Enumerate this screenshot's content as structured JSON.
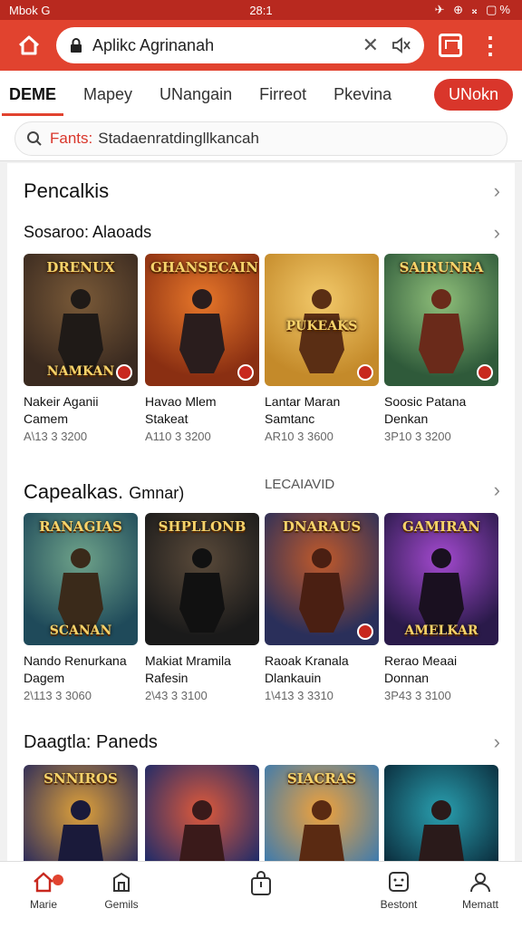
{
  "status": {
    "left": "Mbok G",
    "time": "28:1",
    "right": "✈ ⊕ 𝄪 ▢%"
  },
  "browser": {
    "url": "Aplikc Agrinanah"
  },
  "tabs": [
    {
      "label": "DEME",
      "active": true
    },
    {
      "label": "Mapey"
    },
    {
      "label": "UNangain"
    },
    {
      "label": "Firreot"
    },
    {
      "label": "Pkevina"
    }
  ],
  "tab_cta": "UNokn",
  "search": {
    "prefix": "Fants:",
    "text": "Stadaenratdingllkancah"
  },
  "sections": {
    "pencalkis": {
      "title": "Pencalkis"
    },
    "row1": {
      "title": "Sosaroo: Alaoads",
      "items": [
        {
          "cover_title": "DRENUX",
          "cover_sub": "NAMKAN",
          "name_1": "Nakeir Aganii",
          "name_2": "Camem",
          "price": "A\\13 3 3200",
          "bg1": "#3a2a20",
          "bg2": "#7a5a38",
          "hero": "#1f1a17"
        },
        {
          "cover_title": "GHANSECAIN",
          "cover_sub": "",
          "name_1": "Havao Mlem",
          "name_2": "Stakeat",
          "price": "A110 3 3200",
          "bg1": "#8a2f12",
          "bg2": "#e7772a",
          "hero": "#2a1d1d"
        },
        {
          "cover_title": "",
          "cover_sub": "PUKEAKS",
          "name_1": "Lantar Maran",
          "name_2": "Samtanc",
          "price": "AR10 3 3600",
          "bg1": "#c48a2a",
          "bg2": "#f2c96a",
          "hero": "#5a2e14"
        },
        {
          "cover_title": "SAIRUNRA",
          "cover_sub": "",
          "name_1": "Soosic Patana",
          "name_2": "Denkan",
          "price": "3P10 3 3200",
          "bg1": "#2f5a3a",
          "bg2": "#8fbf7a",
          "hero": "#6a2a1a"
        }
      ]
    },
    "row2": {
      "title": "Capealkas.",
      "title_extra": "Gmnar)",
      "side_label": "LECAIAVID",
      "items": [
        {
          "cover_title": "RANAGIAS",
          "cover_sub": "SCANAN",
          "name_1": "Nando Renurkana",
          "name_2": "Dagem",
          "price": "2\\113 3 3060",
          "bg1": "#1f4a5a",
          "bg2": "#6fa38a",
          "hero": "#3a2a1a"
        },
        {
          "cover_title": "SHPLLONB",
          "cover_sub": "",
          "name_1": "Makiat Mramila",
          "name_2": "Rafesin",
          "price": "2\\43 3 3100",
          "bg1": "#1a1a1a",
          "bg2": "#5a4a3a",
          "hero": "#111111"
        },
        {
          "cover_title": "DNARAUS",
          "cover_sub": "",
          "name_1": "Raoak Kranala",
          "name_2": "Dlankauin",
          "price": "1\\413 3 3310",
          "bg1": "#2a2f5a",
          "bg2": "#c25a2a",
          "hero": "#4a1f12"
        },
        {
          "cover_title": "GAMIRAN",
          "cover_sub": "AMELKAR",
          "name_1": "Rerao Meaai",
          "name_2": "Donnan",
          "price": "3P43 3 3100",
          "bg1": "#2a1a4a",
          "bg2": "#a44ad0",
          "hero": "#1a1020"
        }
      ]
    },
    "row3": {
      "title": "Daagtla: Paneds",
      "items": [
        {
          "cover_title": "SNNIROS",
          "bg1": "#2a2a5a",
          "bg2": "#e0a23a",
          "hero": "#1a1a3a"
        },
        {
          "cover_title": "",
          "bg1": "#1a2a6a",
          "bg2": "#e05a3a",
          "hero": "#3a1a1a"
        },
        {
          "cover_title": "SIACRAS",
          "bg1": "#3a7ab0",
          "bg2": "#f2a23a",
          "hero": "#5a2a12"
        },
        {
          "cover_title": "",
          "bg1": "#0a2a3a",
          "bg2": "#2aa0b0",
          "hero": "#2a1a1a"
        }
      ]
    }
  },
  "bottom_nav": [
    {
      "label": "Marie",
      "icon": "home-icon"
    },
    {
      "label": "Gemils",
      "icon": "store-icon"
    },
    {
      "label": "",
      "icon": "bag-icon"
    },
    {
      "label": "Bestont",
      "icon": "face-icon"
    },
    {
      "label": "Mematt",
      "icon": "profile-icon"
    }
  ],
  "colors": {
    "accent": "#e1432f",
    "status": "#b8291f",
    "cta": "#d9362b"
  }
}
